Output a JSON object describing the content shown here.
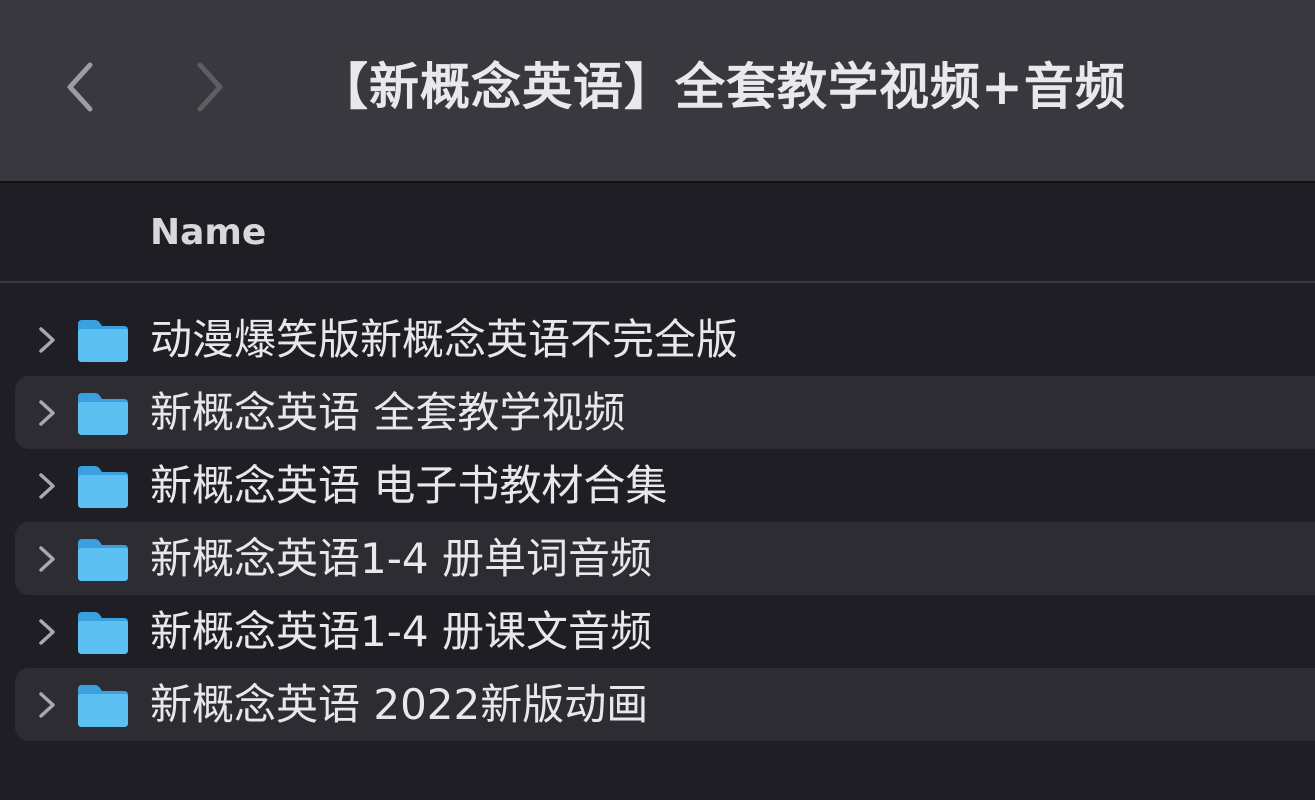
{
  "window": {
    "title": "【新概念英语】全套教学视频+音频"
  },
  "toolbar": {
    "back_icon": "chevron-left-icon",
    "forward_icon": "chevron-right-icon"
  },
  "columns": {
    "name": "Name"
  },
  "items": [
    {
      "label": "动漫爆笑版新概念英语不完全版",
      "icon": "folder-icon"
    },
    {
      "label": "新概念英语 全套教学视频",
      "icon": "folder-icon"
    },
    {
      "label": "新概念英语 电子书教材合集",
      "icon": "folder-icon"
    },
    {
      "label": "新概念英语1-4 册单词音频",
      "icon": "folder-icon"
    },
    {
      "label": "新概念英语1-4 册课文音频",
      "icon": "folder-icon"
    },
    {
      "label": "新概念英语 2022新版动画",
      "icon": "folder-icon"
    }
  ],
  "colors": {
    "toolbar_bg": "#39383e",
    "list_bg": "#1f1e25",
    "alt_row_bg": "#2d2c33",
    "folder_blue": "#4fb3ec"
  }
}
